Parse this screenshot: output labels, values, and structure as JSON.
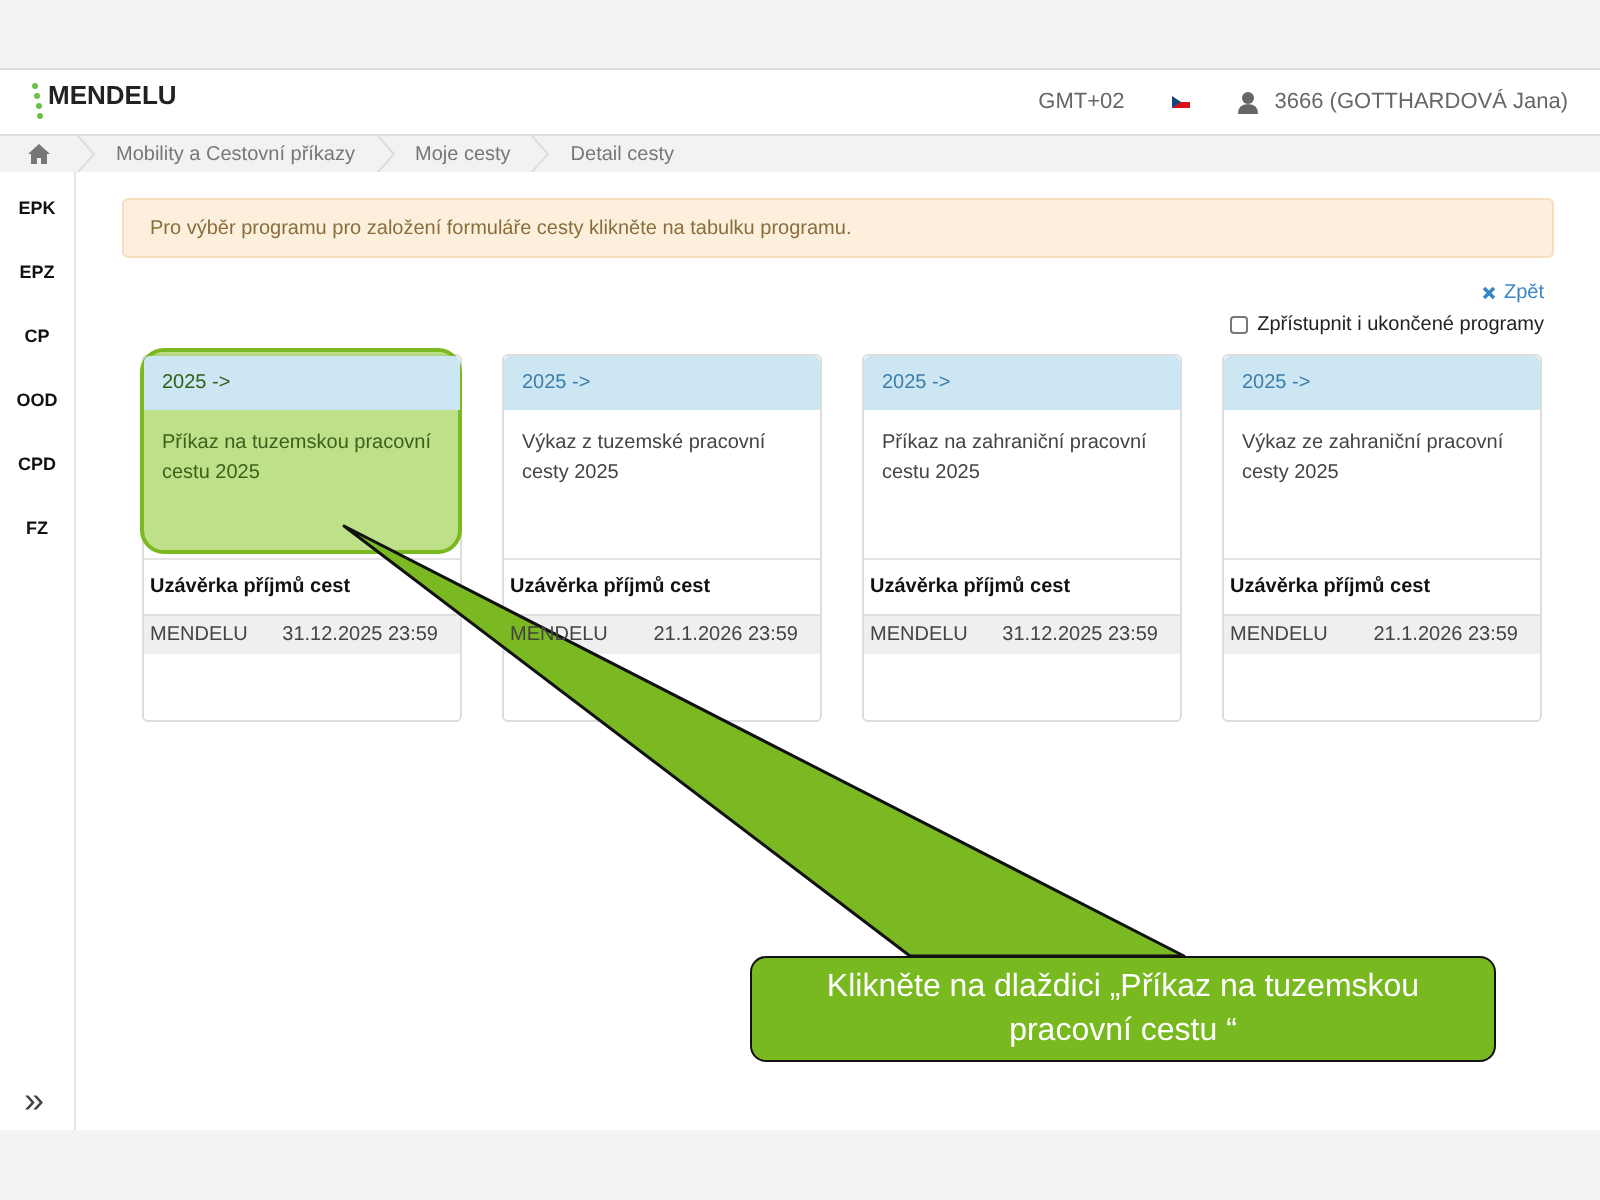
{
  "header": {
    "logo": "MENDELU",
    "timezone": "GMT+02",
    "user": "3666 (GOTTHARDOVÁ Jana)"
  },
  "breadcrumb": [
    "Mobility a Cestovní příkazy",
    "Moje cesty",
    "Detail cesty"
  ],
  "sidebar": {
    "items": [
      "EPK",
      "EPZ",
      "CP",
      "OOD",
      "CPD",
      "FZ"
    ],
    "expand": "»"
  },
  "alert": "Pro výběr programu pro založení formuláře cesty klikněte na tabulku programu.",
  "back_link": "Zpět",
  "show_ended": {
    "label": "Zpřístupnit i ukončené programy",
    "checked": false
  },
  "tiles": [
    {
      "period": "2025 ->",
      "title": "Příkaz na tuzemskou pracovní cestu 2025",
      "deadline_heading": "Uzávěrka příjmů cest",
      "org": "MENDELU",
      "deadline": "31.12.2025 23:59",
      "highlighted": true
    },
    {
      "period": "2025 ->",
      "title": "Výkaz z tuzemské pracovní cesty 2025",
      "deadline_heading": "Uzávěrka příjmů cest",
      "org": "MENDELU",
      "deadline": "21.1.2026 23:59",
      "highlighted": false
    },
    {
      "period": "2025 ->",
      "title": "Příkaz na zahraniční pracovní cestu 2025",
      "deadline_heading": "Uzávěrka příjmů cest",
      "org": "MENDELU",
      "deadline": "31.12.2025 23:59",
      "highlighted": false
    },
    {
      "period": "2025 ->",
      "title": "Výkaz ze zahraniční pracovní cesty 2025",
      "deadline_heading": "Uzávěrka příjmů cest",
      "org": "MENDELU",
      "deadline": "21.1.2026 23:59",
      "highlighted": false
    }
  ],
  "callout": {
    "text": "Klikněte na dlaždici  „Příkaz na tuzemskou pracovní cestu “"
  }
}
